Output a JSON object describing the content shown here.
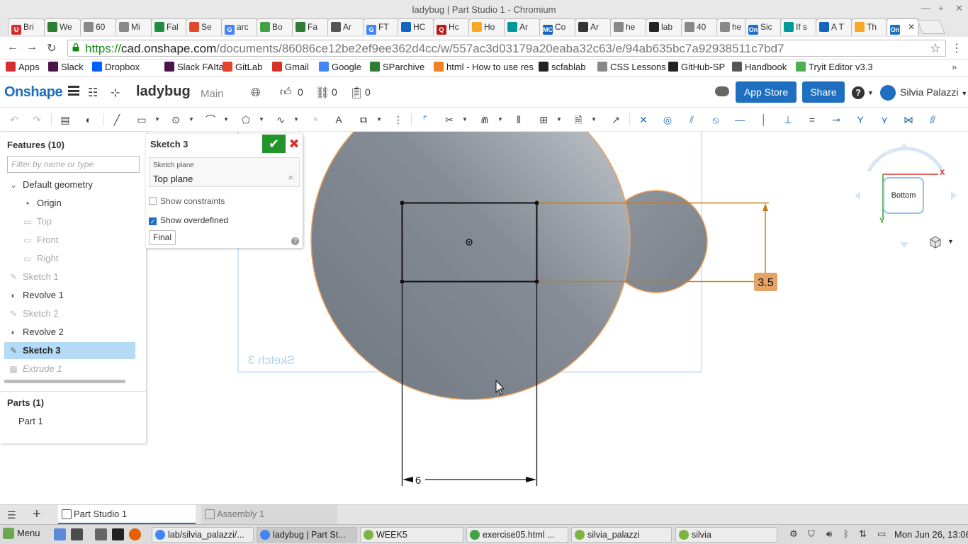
{
  "window": {
    "title": "ladybug | Part Studio 1 - Chromium"
  },
  "browser_tabs": [
    {
      "label": "Bri",
      "color": "#d32f2f",
      "letter": "U"
    },
    {
      "label": "We",
      "color": "#2e7d32",
      "letter": ""
    },
    {
      "label": "60",
      "color": "#888888",
      "letter": ""
    },
    {
      "label": "Mi",
      "color": "#888888",
      "letter": ""
    },
    {
      "label": "Fal",
      "color": "#1e8e3e",
      "letter": ""
    },
    {
      "label": "Se",
      "color": "#e04a2b",
      "letter": ""
    },
    {
      "label": "arc",
      "color": "#4285f4",
      "letter": "G"
    },
    {
      "label": "Bo",
      "color": "#43a047",
      "letter": ""
    },
    {
      "label": "Fa",
      "color": "#2e7d32",
      "letter": ""
    },
    {
      "label": "Ar",
      "color": "#555555",
      "letter": ""
    },
    {
      "label": "FT",
      "color": "#4285f4",
      "letter": "G"
    },
    {
      "label": "HC",
      "color": "#1565c0",
      "letter": ""
    },
    {
      "label": "Hc",
      "color": "#b71c1c",
      "letter": "Q"
    },
    {
      "label": "Ho",
      "color": "#f9a825",
      "letter": ""
    },
    {
      "label": "Ar",
      "color": "#00979d",
      "letter": ""
    },
    {
      "label": "Co",
      "color": "#1565c0",
      "letter": "MC"
    },
    {
      "label": "Ar",
      "color": "#333333",
      "letter": ""
    },
    {
      "label": "he",
      "color": "#888888",
      "letter": ""
    },
    {
      "label": "lab",
      "color": "#222222",
      "letter": ""
    },
    {
      "label": "40",
      "color": "#888888",
      "letter": ""
    },
    {
      "label": "he",
      "color": "#888888",
      "letter": ""
    },
    {
      "label": "Sic",
      "color": "#1f6fc0",
      "letter": "On"
    },
    {
      "label": "If s",
      "color": "#00979d",
      "letter": ""
    },
    {
      "label": "A T",
      "color": "#1565c0",
      "letter": ""
    },
    {
      "label": "Th",
      "color": "#f9a825",
      "letter": ""
    },
    {
      "label": "",
      "color": "#1f6fc0",
      "letter": "On"
    }
  ],
  "address_bar": {
    "scheme": "https://",
    "host": "cad.onshape.com",
    "path": "/documents/86086ce12be2ef9ee362d4cc/w/557ac3d03179a20eaba32c63/e/94ab635bc7a92938511c7bd7"
  },
  "bookmarks": [
    {
      "label": "Apps",
      "color": "#d32f2f"
    },
    {
      "label": "Slack",
      "color": "#4a154b"
    },
    {
      "label": "Dropbox",
      "color": "#0061ff"
    },
    {
      "label": "Slack FAItaly",
      "color": "#4a154b"
    },
    {
      "label": "GitLab",
      "color": "#e24329"
    },
    {
      "label": "Gmail",
      "color": "#d93025"
    },
    {
      "label": "Google",
      "color": "#4285f4"
    },
    {
      "label": "SParchive",
      "color": "#2e7d32"
    },
    {
      "label": "html - How to use res",
      "color": "#f48024"
    },
    {
      "label": "scfablab",
      "color": "#222222"
    },
    {
      "label": "CSS Lessons",
      "color": "#888888"
    },
    {
      "label": "GitHub-SP",
      "color": "#222222"
    },
    {
      "label": "Handbook",
      "color": "#555555"
    },
    {
      "label": "Tryit Editor v3.3",
      "color": "#4caf50"
    }
  ],
  "onshape_header": {
    "logo": "Onshape",
    "document_name": "ladybug",
    "workspace": "Main",
    "likes": "0",
    "links": "0",
    "copies": "0",
    "app_store_label": "App Store",
    "share_label": "Share",
    "help": "?",
    "user_name": "Silvia Palazzi"
  },
  "feature_tree": {
    "title": "Features (10)",
    "filter_placeholder": "Filter by name or type",
    "items": [
      {
        "label": "Default geometry",
        "icon": "chevron-down-icon",
        "glyph": "⌄",
        "state": "normal"
      },
      {
        "label": "Origin",
        "icon": "origin-icon",
        "glyph": "•",
        "state": "normal"
      },
      {
        "label": "Top",
        "icon": "plane-icon",
        "glyph": "▭",
        "state": "dim"
      },
      {
        "label": "Front",
        "icon": "plane-icon",
        "glyph": "▭",
        "state": "dim"
      },
      {
        "label": "Right",
        "icon": "plane-icon",
        "glyph": "▭",
        "state": "dim"
      },
      {
        "label": "Sketch 1",
        "icon": "sketch-pencil-icon",
        "glyph": "✎",
        "state": "dim"
      },
      {
        "label": "Revolve 1",
        "icon": "revolve-icon",
        "glyph": "◐",
        "state": "normal"
      },
      {
        "label": "Sketch 2",
        "icon": "sketch-pencil-icon",
        "glyph": "✎",
        "state": "dim"
      },
      {
        "label": "Revolve 2",
        "icon": "revolve-icon",
        "glyph": "◐",
        "state": "normal"
      },
      {
        "label": "Sketch 3",
        "icon": "sketch-pencil-icon",
        "glyph": "✎",
        "state": "selected"
      },
      {
        "label": "Extrude 1",
        "icon": "extrude-icon",
        "glyph": "▦",
        "state": "dim-italic"
      }
    ],
    "parts_title": "Parts (1)",
    "parts": [
      "Part 1"
    ]
  },
  "sketch_dialog": {
    "title": "Sketch 3",
    "plane_label": "Sketch plane",
    "plane_value": "Top plane",
    "show_constraints_label": "Show constraints",
    "show_constraints_checked": false,
    "show_overdefined_label": "Show overdefined",
    "show_overdefined_checked": true,
    "final_label": "Final"
  },
  "viewport": {
    "sketch_label": "Sketch 3",
    "dimension_vertical": "3.5",
    "dimension_horizontal": "6",
    "body_color": "#7e8690",
    "edge_color": "#f3a25a",
    "dimension_color": "#c77a1e"
  },
  "view_cube": {
    "face_label": "Bottom",
    "x_label": "X",
    "y_label": "Y"
  },
  "bottom_tabs": [
    {
      "label": "Part Studio 1",
      "active": true
    },
    {
      "label": "Assembly 1",
      "active": false
    }
  ],
  "taskbar": {
    "menu_label": "Menu",
    "tasks": [
      {
        "label": "lab/silvia_palazzi/...",
        "color": "#4285f4"
      },
      {
        "label": "ladybug | Part St...",
        "color": "#4285f4"
      },
      {
        "label": "WEEK5",
        "color": "#7cb342"
      },
      {
        "label": "exercise05.html ...",
        "color": "#43a047"
      },
      {
        "label": "silvia_palazzi",
        "color": "#7cb342"
      },
      {
        "label": "silvia",
        "color": "#7cb342"
      }
    ],
    "clock": "Mon Jun 26, 13:06"
  }
}
